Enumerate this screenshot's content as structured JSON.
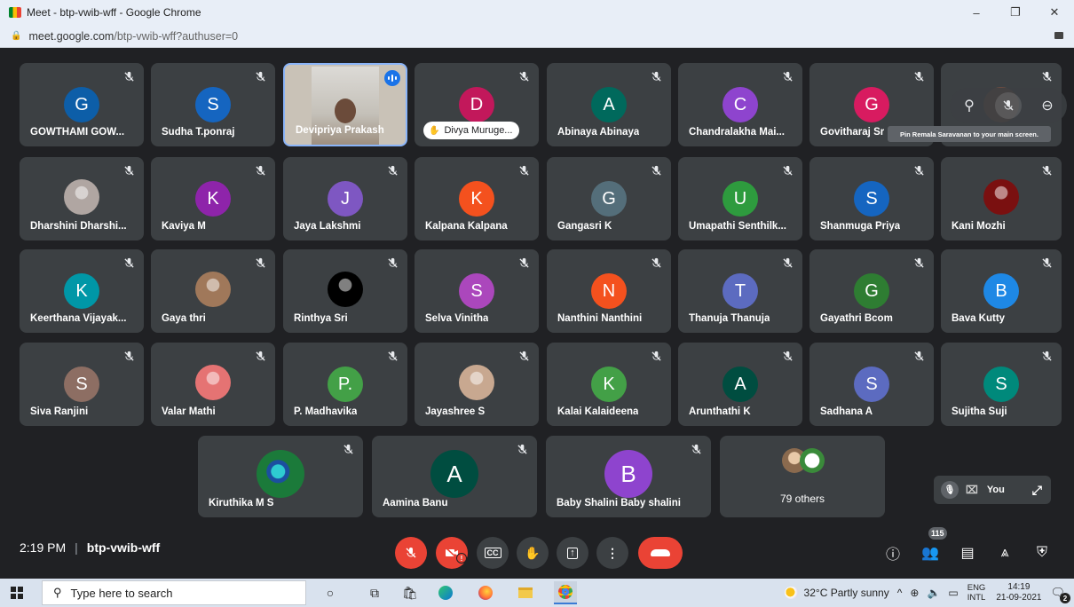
{
  "browser": {
    "window_title": "Meet - btp-vwib-wff - Google Chrome",
    "url_host": "meet.google.com",
    "url_path": "/btp-vwib-wff?authuser=0",
    "minimize": "–",
    "restore": "❐",
    "close": "✕"
  },
  "tooltip": "Pin Remala Saravanan to your main screen.",
  "participants": [
    {
      "name": "GOWTHAMI GOW...",
      "initial": "G",
      "color": "#0d5ea8"
    },
    {
      "name": "Sudha T.ponraj",
      "initial": "S",
      "color": "#1565c0"
    },
    {
      "name": "Devipriya Prakash",
      "initial": "",
      "color": "",
      "video": true
    },
    {
      "name": "Divya Muruge...",
      "initial": "D",
      "color": "#c2185b",
      "hand": true
    },
    {
      "name": "Abinaya Abinaya",
      "initial": "A",
      "color": "#00695c"
    },
    {
      "name": "Chandralakha Mai...",
      "initial": "C",
      "color": "#8e44ce"
    },
    {
      "name": "Govitharaj Sr",
      "initial": "G",
      "color": "#d81b60"
    },
    {
      "name": "",
      "initial": "",
      "color": "#6d4c41"
    },
    {
      "name": "Dharshini Dharshi...",
      "initial": "",
      "color": "#b0a6a2",
      "photo": true
    },
    {
      "name": "Kaviya M",
      "initial": "K",
      "color": "#8e24aa"
    },
    {
      "name": "Jaya Lakshmi",
      "initial": "J",
      "color": "#7e57c2"
    },
    {
      "name": "Kalpana Kalpana",
      "initial": "K",
      "color": "#f4511e"
    },
    {
      "name": "Gangasri K",
      "initial": "G",
      "color": "#546e7a"
    },
    {
      "name": "Umapathi Senthilk...",
      "initial": "U",
      "color": "#2e9b3e"
    },
    {
      "name": "Shanmuga Priya",
      "initial": "S",
      "color": "#1565c0"
    },
    {
      "name": "Kani Mozhi",
      "initial": "",
      "color": "#7a1010",
      "photo": true
    },
    {
      "name": "Keerthana Vijayak...",
      "initial": "K",
      "color": "#0097a7"
    },
    {
      "name": "Gaya thri",
      "initial": "",
      "color": "#a0785a",
      "photo": true
    },
    {
      "name": "Rinthya Sri",
      "initial": "",
      "color": "#000000",
      "photo": true
    },
    {
      "name": "Selva Vinitha",
      "initial": "S",
      "color": "#ab47bc"
    },
    {
      "name": "Nanthini Nanthini",
      "initial": "N",
      "color": "#f4511e"
    },
    {
      "name": "Thanuja Thanuja",
      "initial": "T",
      "color": "#5c6bc0"
    },
    {
      "name": "Gayathri Bcom",
      "initial": "G",
      "color": "#2e7d32"
    },
    {
      "name": "Bava Kutty",
      "initial": "B",
      "color": "#1e88e5"
    },
    {
      "name": "Siva Ranjini",
      "initial": "S",
      "color": "#8d6e63"
    },
    {
      "name": "Valar Mathi",
      "initial": "",
      "color": "#e57373",
      "photo": true
    },
    {
      "name": "P. Madhavika",
      "initial": "P.",
      "color": "#43a047"
    },
    {
      "name": "Jayashree S",
      "initial": "",
      "color": "#c8a890",
      "photo": true
    },
    {
      "name": "Kalai Kalaideena",
      "initial": "K",
      "color": "#43a047"
    },
    {
      "name": "Arunthathi K",
      "initial": "A",
      "color": "#004d40"
    },
    {
      "name": "Sadhana A",
      "initial": "S",
      "color": "#5c6bc0"
    },
    {
      "name": "Sujitha Suji",
      "initial": "S",
      "color": "#00897b"
    }
  ],
  "bottom_row": [
    {
      "name": "Kiruthika M S",
      "initial": "",
      "color": "#1b7a3a",
      "photo": true
    },
    {
      "name": "Aamina Banu",
      "initial": "A",
      "color": "#004d40"
    },
    {
      "name": "Baby Shalini Baby shalini",
      "initial": "B",
      "color": "#8e44ce"
    }
  ],
  "others_label": "79 others",
  "self_label": "You",
  "meeting": {
    "time": "2:19 PM",
    "separator": "|",
    "code": "btp-vwib-wff"
  },
  "participant_count": "115",
  "cam_badge": "!",
  "taskbar": {
    "search_placeholder": "Type here to search",
    "weather": "32°C  Partly sunny",
    "lang_top": "ENG",
    "lang_bottom": "INTL",
    "clock_time": "14:19",
    "clock_date": "21-09-2021",
    "notif_count": "2"
  }
}
